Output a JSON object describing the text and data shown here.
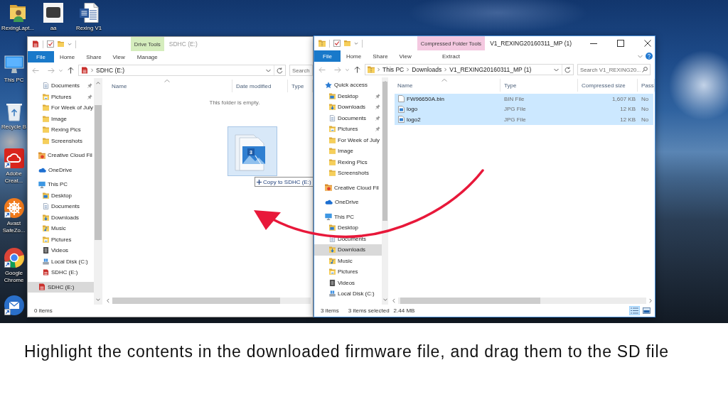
{
  "desktop": {
    "icons": [
      {
        "label": "RexingLapt...",
        "kind": "user-folder",
        "shortcut": false
      },
      {
        "label": "aa",
        "kind": "photo",
        "shortcut": false
      },
      {
        "label": "Rexing V1",
        "kind": "word-document",
        "shortcut": false
      },
      {
        "label": "This PC",
        "kind": "computer",
        "shortcut": false
      },
      {
        "label": "Recycle B",
        "kind": "recycle-bin",
        "shortcut": false
      },
      {
        "label": "Adobe Creat...",
        "kind": "creative-cloud",
        "shortcut": true
      },
      {
        "label": "Avast SafeZo...",
        "kind": "avast",
        "shortcut": true
      },
      {
        "label": "Google Chrome",
        "kind": "chrome",
        "shortcut": true
      },
      {
        "kind": "thunderbird",
        "shortcut": true
      }
    ]
  },
  "windows": [
    {
      "active": false,
      "title": "SDHC (E:)",
      "context": {
        "label": "Drive Tools",
        "tab": "Manage",
        "color": "#d5edbd"
      },
      "tabs": [
        {
          "label": "File",
          "kind": "file"
        },
        {
          "label": "Home",
          "kind": "tab"
        },
        {
          "label": "Share",
          "kind": "tab"
        },
        {
          "label": "View",
          "kind": "tab"
        }
      ],
      "controls": false,
      "address": {
        "kind": "sd",
        "path": [
          "SDHC (E:)"
        ]
      },
      "search": {
        "placeholder": "Search"
      },
      "nav": [
        {
          "children": [
            {
              "label": "Documents",
              "kind": "documents",
              "pinned": true,
              "selected": false
            },
            {
              "label": "Pictures",
              "kind": "pictures",
              "pinned": true,
              "selected": false
            },
            {
              "label": "For Week of July",
              "kind": "folder",
              "pinned": false,
              "selected": false
            },
            {
              "label": "Image",
              "kind": "folder",
              "pinned": false,
              "selected": false
            },
            {
              "label": "Rexing Pics",
              "kind": "folder",
              "pinned": false,
              "selected": false
            },
            {
              "label": "Screenshots",
              "kind": "folder",
              "pinned": false,
              "selected": false
            }
          ]
        },
        {
          "label": "Creative Cloud Fil",
          "kind": "cloud-files",
          "pinned": false,
          "selected": false
        },
        {
          "label": "OneDrive",
          "kind": "onedrive",
          "pinned": false,
          "selected": false
        },
        {
          "label": "This PC",
          "kind": "pc",
          "pinned": false,
          "selected": false,
          "children": [
            {
              "label": "Desktop",
              "kind": "desktop",
              "pinned": false,
              "selected": false
            },
            {
              "label": "Documents",
              "kind": "documents",
              "pinned": false,
              "selected": false
            },
            {
              "label": "Downloads",
              "kind": "downloads",
              "pinned": false,
              "selected": false
            },
            {
              "label": "Music",
              "kind": "music",
              "pinned": false,
              "selected": false
            },
            {
              "label": "Pictures",
              "kind": "pictures",
              "pinned": false,
              "selected": false
            },
            {
              "label": "Videos",
              "kind": "videos",
              "pinned": false,
              "selected": false
            },
            {
              "label": "Local Disk (C:)",
              "kind": "disk",
              "pinned": false,
              "selected": false
            },
            {
              "label": "SDHC (E:)",
              "kind": "sd",
              "pinned": false,
              "selected": false
            }
          ]
        },
        {
          "label": "SDHC (E:)",
          "kind": "sd",
          "pinned": false,
          "selected": true
        }
      ],
      "columns": [
        {
          "label": "Name",
          "sorted": true
        },
        {
          "label": "Date modified",
          "sorted": false
        },
        {
          "label": "Type",
          "sorted": false
        }
      ],
      "empty_message": "This folder is empty.",
      "drop": {
        "count": "3",
        "tooltip": "Copy to SDHC (E:)"
      },
      "status": [
        "0 items"
      ]
    },
    {
      "active": true,
      "title": "V1_REXING20160311_MP (1)",
      "context": {
        "label": "Compressed Folder Tools",
        "tab": "Extract",
        "color": "#f4c8e0"
      },
      "tabs": [
        {
          "label": "File",
          "kind": "file"
        },
        {
          "label": "Home",
          "kind": "tab"
        },
        {
          "label": "Share",
          "kind": "tab"
        },
        {
          "label": "View",
          "kind": "tab"
        }
      ],
      "controls": true,
      "address": {
        "kind": "zip",
        "path": [
          "This PC",
          "Downloads",
          "V1_REXING20160311_MP (1)"
        ]
      },
      "search": {
        "placeholder": "Search V1_REXING20..."
      },
      "nav": [
        {
          "label": "Quick access",
          "kind": "star",
          "pinned": false,
          "selected": false,
          "children": [
            {
              "label": "Desktop",
              "kind": "desktop",
              "pinned": true,
              "selected": false
            },
            {
              "label": "Downloads",
              "kind": "downloads",
              "pinned": true,
              "selected": false
            },
            {
              "label": "Documents",
              "kind": "documents",
              "pinned": true,
              "selected": false
            },
            {
              "label": "Pictures",
              "kind": "pictures",
              "pinned": true,
              "selected": false
            },
            {
              "label": "For Week of July",
              "kind": "folder",
              "pinned": false,
              "selected": false
            },
            {
              "label": "Image",
              "kind": "folder",
              "pinned": false,
              "selected": false
            },
            {
              "label": "Rexing Pics",
              "kind": "folder",
              "pinned": false,
              "selected": false
            },
            {
              "label": "Screenshots",
              "kind": "folder",
              "pinned": false,
              "selected": false
            }
          ]
        },
        {
          "label": "Creative Cloud Fil",
          "kind": "cloud-files",
          "pinned": false,
          "selected": false
        },
        {
          "label": "OneDrive",
          "kind": "onedrive",
          "pinned": false,
          "selected": false
        },
        {
          "label": "This PC",
          "kind": "pc",
          "pinned": false,
          "selected": false,
          "children": [
            {
              "label": "Desktop",
              "kind": "desktop",
              "pinned": false,
              "selected": false
            },
            {
              "label": "Documents",
              "kind": "documents",
              "pinned": false,
              "selected": false
            },
            {
              "label": "Downloads",
              "kind": "downloads",
              "pinned": false,
              "selected": true
            },
            {
              "label": "Music",
              "kind": "music",
              "pinned": false,
              "selected": false
            },
            {
              "label": "Pictures",
              "kind": "pictures",
              "pinned": false,
              "selected": false
            },
            {
              "label": "Videos",
              "kind": "videos",
              "pinned": false,
              "selected": false
            },
            {
              "label": "Local Disk (C:)",
              "kind": "disk",
              "pinned": false,
              "selected": false
            }
          ]
        }
      ],
      "columns": [
        {
          "label": "Name",
          "sorted": true
        },
        {
          "label": "Type",
          "sorted": false
        },
        {
          "label": "Compressed size",
          "sorted": false
        },
        {
          "label": "Pass",
          "sorted": false
        }
      ],
      "rows": [
        {
          "kind": "file",
          "selected": true,
          "cells": [
            "FW96650A.bin",
            "BIN File",
            "1,607 KB",
            "No"
          ]
        },
        {
          "kind": "image",
          "selected": true,
          "cells": [
            "logo",
            "JPG File",
            "12 KB",
            "No"
          ]
        },
        {
          "kind": "image",
          "selected": true,
          "cells": [
            "logo2",
            "JPG File",
            "12 KB",
            "No"
          ]
        }
      ],
      "status": [
        "3 items",
        "3 items selected",
        "2.44 MB"
      ],
      "view_buttons": [
        {
          "kind": "details",
          "selected": true
        },
        {
          "kind": "large-icons",
          "selected": false
        }
      ]
    }
  ],
  "caption": "Highlight the contents in the downloaded firmware file, and drag them to the SD file"
}
